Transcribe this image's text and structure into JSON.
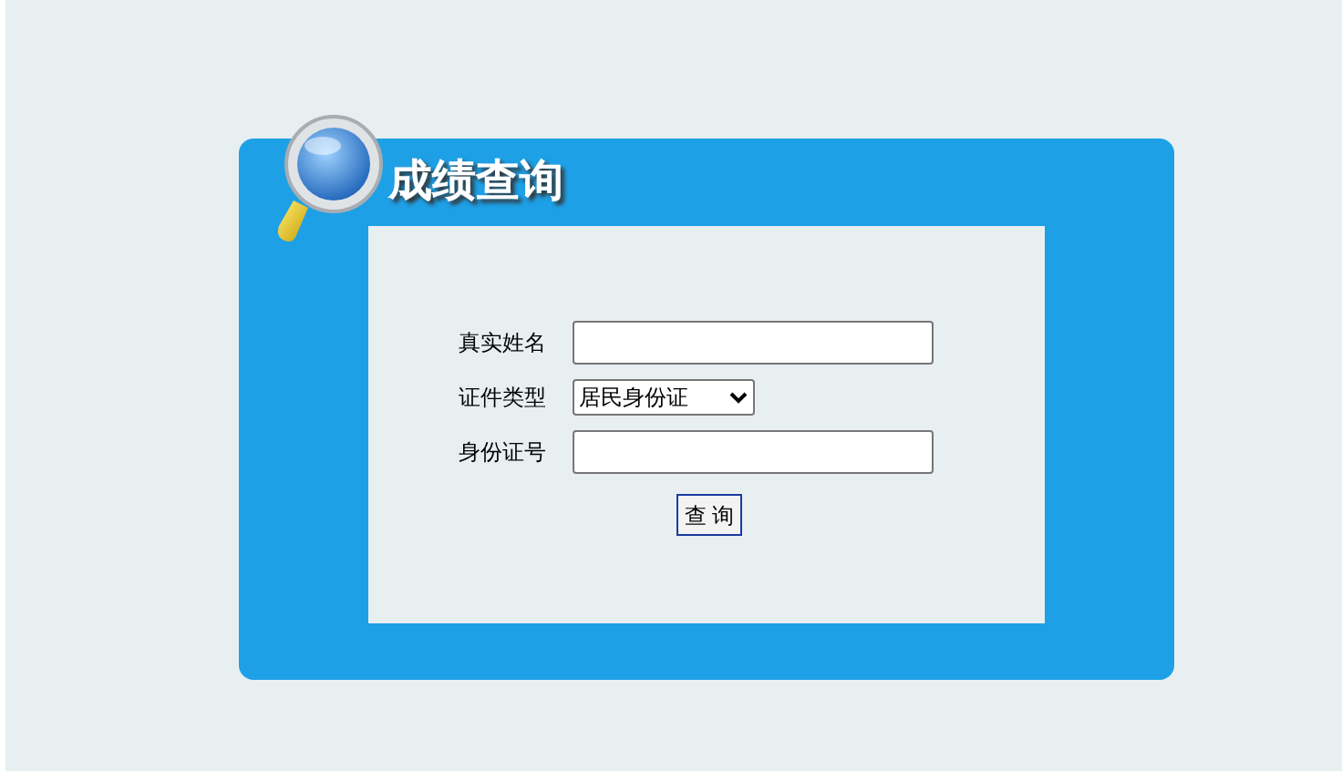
{
  "panel": {
    "title": "成绩查询"
  },
  "form": {
    "fields": [
      {
        "label": "真实姓名",
        "kind": "input"
      },
      {
        "label": "证件类型",
        "kind": "select",
        "value": "居民身份证"
      },
      {
        "label": "身份证号",
        "kind": "input"
      }
    ],
    "button": "查 询"
  }
}
